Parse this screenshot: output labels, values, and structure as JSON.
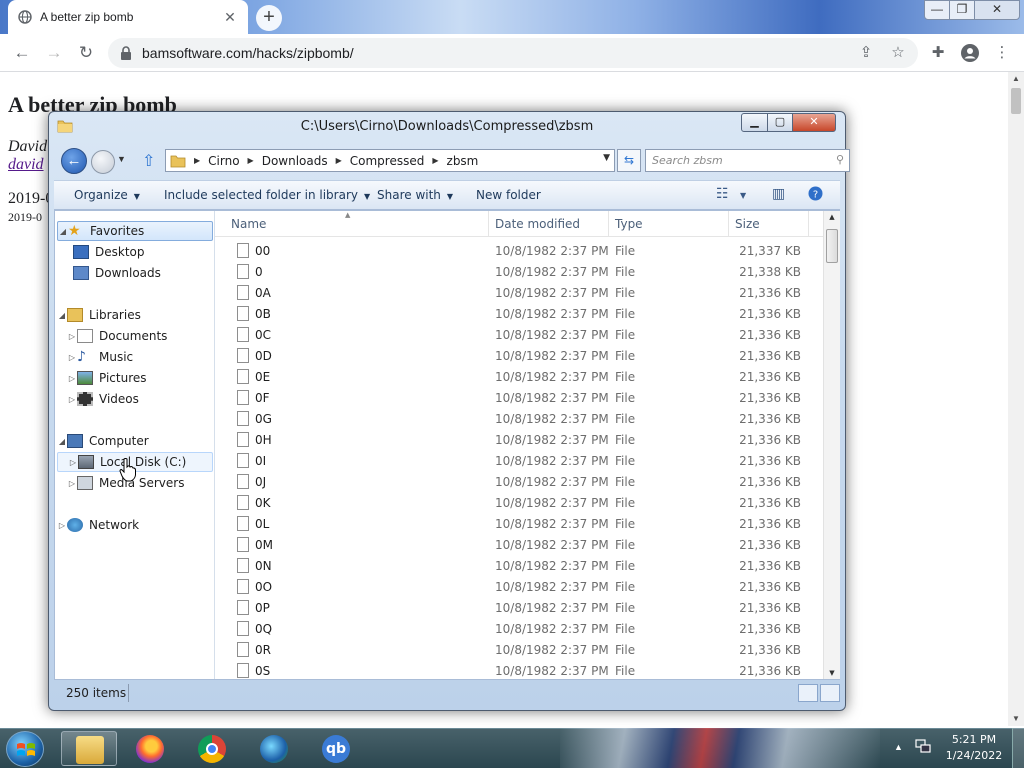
{
  "browser": {
    "tab_title": "A better zip bomb",
    "url": "bamsoftware.com/hacks/zipbomb/"
  },
  "webpage": {
    "heading": "A better zip bomb",
    "author": "David",
    "email": "david",
    "date1": "2019-0",
    "date2": "2019-0"
  },
  "explorer": {
    "title": "C:\\Users\\Cirno\\Downloads\\Compressed\\zbsm",
    "breadcrumb": [
      "Cirno",
      "Downloads",
      "Compressed",
      "zbsm"
    ],
    "search_placeholder": "Search zbsm",
    "commands": {
      "organize": "Organize",
      "include": "Include selected folder in library",
      "share": "Share with",
      "new_folder": "New folder"
    },
    "nav": {
      "favorites": "Favorites",
      "desktop": "Desktop",
      "downloads": "Downloads",
      "libraries": "Libraries",
      "documents": "Documents",
      "music": "Music",
      "pictures": "Pictures",
      "videos": "Videos",
      "computer": "Computer",
      "local_disk": "Local Disk (C:)",
      "media_servers": "Media Servers",
      "network": "Network"
    },
    "columns": {
      "name": "Name",
      "date": "Date modified",
      "type": "Type",
      "size": "Size"
    },
    "files": [
      {
        "name": "00",
        "date": "10/8/1982 2:37 PM",
        "type": "File",
        "size": "21,337 KB"
      },
      {
        "name": "0",
        "date": "10/8/1982 2:37 PM",
        "type": "File",
        "size": "21,338 KB"
      },
      {
        "name": "0A",
        "date": "10/8/1982 2:37 PM",
        "type": "File",
        "size": "21,336 KB"
      },
      {
        "name": "0B",
        "date": "10/8/1982 2:37 PM",
        "type": "File",
        "size": "21,336 KB"
      },
      {
        "name": "0C",
        "date": "10/8/1982 2:37 PM",
        "type": "File",
        "size": "21,336 KB"
      },
      {
        "name": "0D",
        "date": "10/8/1982 2:37 PM",
        "type": "File",
        "size": "21,336 KB"
      },
      {
        "name": "0E",
        "date": "10/8/1982 2:37 PM",
        "type": "File",
        "size": "21,336 KB"
      },
      {
        "name": "0F",
        "date": "10/8/1982 2:37 PM",
        "type": "File",
        "size": "21,336 KB"
      },
      {
        "name": "0G",
        "date": "10/8/1982 2:37 PM",
        "type": "File",
        "size": "21,336 KB"
      },
      {
        "name": "0H",
        "date": "10/8/1982 2:37 PM",
        "type": "File",
        "size": "21,336 KB"
      },
      {
        "name": "0I",
        "date": "10/8/1982 2:37 PM",
        "type": "File",
        "size": "21,336 KB"
      },
      {
        "name": "0J",
        "date": "10/8/1982 2:37 PM",
        "type": "File",
        "size": "21,336 KB"
      },
      {
        "name": "0K",
        "date": "10/8/1982 2:37 PM",
        "type": "File",
        "size": "21,336 KB"
      },
      {
        "name": "0L",
        "date": "10/8/1982 2:37 PM",
        "type": "File",
        "size": "21,336 KB"
      },
      {
        "name": "0M",
        "date": "10/8/1982 2:37 PM",
        "type": "File",
        "size": "21,336 KB"
      },
      {
        "name": "0N",
        "date": "10/8/1982 2:37 PM",
        "type": "File",
        "size": "21,336 KB"
      },
      {
        "name": "0O",
        "date": "10/8/1982 2:37 PM",
        "type": "File",
        "size": "21,336 KB"
      },
      {
        "name": "0P",
        "date": "10/8/1982 2:37 PM",
        "type": "File",
        "size": "21,336 KB"
      },
      {
        "name": "0Q",
        "date": "10/8/1982 2:37 PM",
        "type": "File",
        "size": "21,336 KB"
      },
      {
        "name": "0R",
        "date": "10/8/1982 2:37 PM",
        "type": "File",
        "size": "21,336 KB"
      },
      {
        "name": "0S",
        "date": "10/8/1982 2:37 PM",
        "type": "File",
        "size": "21,336 KB"
      }
    ],
    "status": "250 items"
  },
  "taskbar": {
    "time": "5:21 PM",
    "date": "1/24/2022",
    "apps": [
      "file-explorer",
      "firefox",
      "chrome",
      "internet-download-manager",
      "qbittorrent"
    ]
  },
  "icons": {
    "tab_favicon": "globe-icon",
    "lock": "lock-icon",
    "folder": "folder-icon",
    "file": "file-icon"
  },
  "colors": {
    "accent": "#1f57b0",
    "selection": "#d3e6fb",
    "close_red": "#c7472a"
  }
}
